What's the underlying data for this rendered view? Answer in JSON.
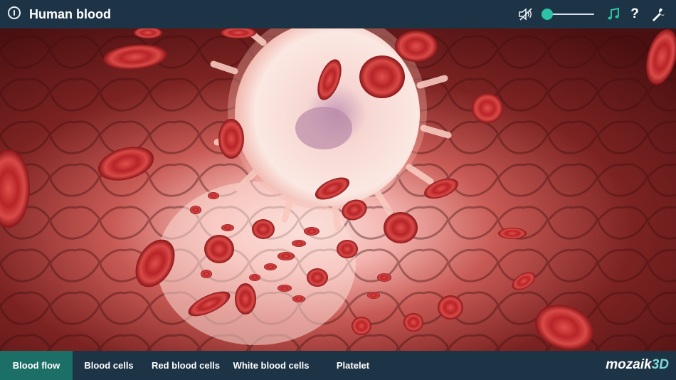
{
  "header": {
    "title": "Human blood",
    "volume_percent": 5
  },
  "tabs": [
    {
      "label": "Blood flow",
      "active": true
    },
    {
      "label": "Blood cells",
      "active": false
    },
    {
      "label": "Red blood cells",
      "active": false
    },
    {
      "label": "White blood cells",
      "active": false
    },
    {
      "label": "Platelet",
      "active": false
    }
  ],
  "brand": {
    "name": "mozaik",
    "suffix": "3D"
  },
  "colors": {
    "bar": "#1d3446",
    "accent": "#2fc1a7",
    "active_tab": "#1c6f66"
  }
}
